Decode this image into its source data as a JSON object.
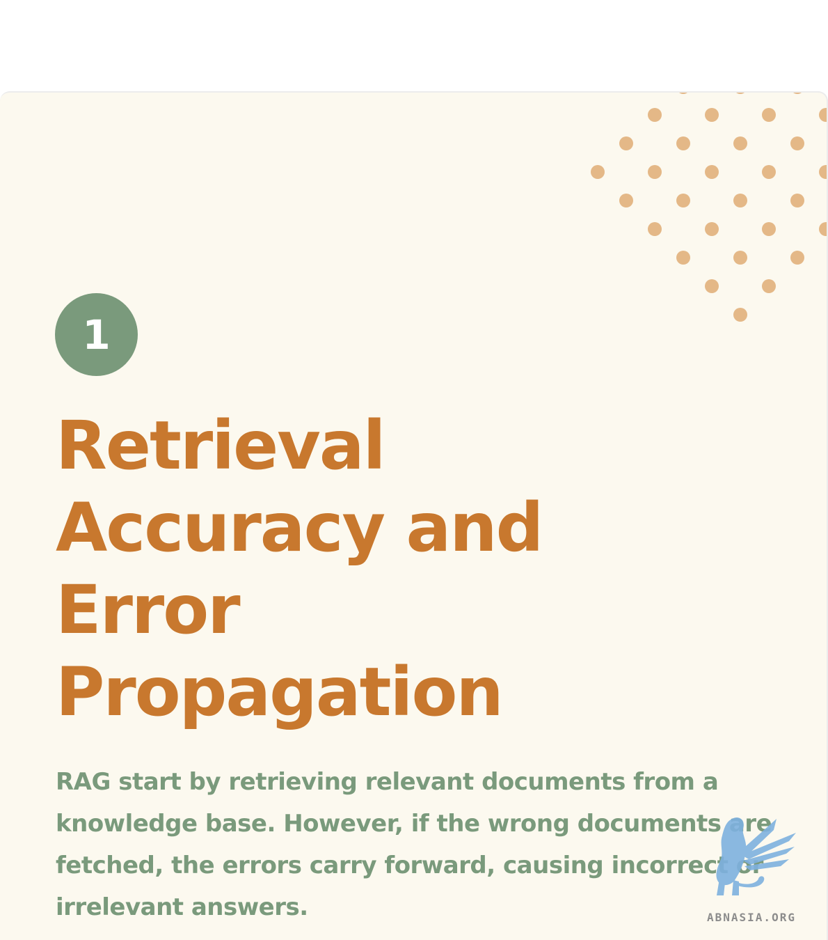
{
  "card": {
    "badge_number": "1",
    "title_lines": [
      "Retrieval",
      "Accuracy and",
      "Error",
      "Propagation"
    ],
    "description": "RAG start by retrieving relevant documents from a knowledge base. However, if the wrong documents are fetched, the errors carry forward, causing incorrect or irrelevant answers."
  },
  "watermark": {
    "text": "ABNASIA.ORG",
    "icon": "winged-lion-icon"
  },
  "colors": {
    "background": "#fcf9ef",
    "title": "#c8782e",
    "body_text": "#7a9a7c",
    "badge": "#7a9a7c",
    "dots": "#e4b887",
    "watermark_icon": "#7eb1df"
  }
}
